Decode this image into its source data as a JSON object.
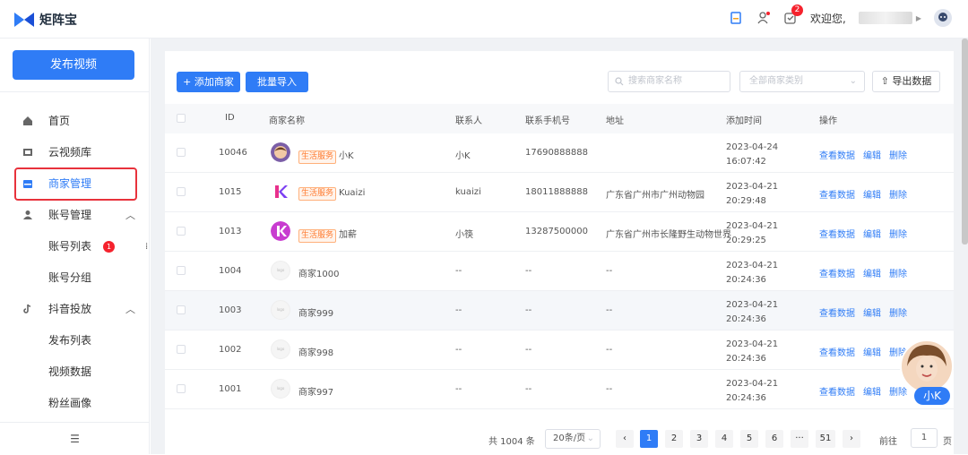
{
  "app": {
    "name": "矩阵宝"
  },
  "header": {
    "notify_count": "2",
    "welcome": "欢迎您,"
  },
  "sidebar": {
    "publish_label": "发布视频",
    "items": [
      {
        "label": "首页",
        "icon": "home-icon"
      },
      {
        "label": "云视频库",
        "icon": "video-library-icon"
      },
      {
        "label": "商家管理",
        "icon": "store-icon",
        "active": true
      },
      {
        "label": "账号管理",
        "icon": "user-icon",
        "expand": "^"
      },
      {
        "label": "账号列表",
        "badge": "1"
      },
      {
        "label": "账号分组"
      },
      {
        "label": "抖音投放",
        "icon": "tiktok-icon",
        "expand": "^"
      },
      {
        "label": "发布列表"
      },
      {
        "label": "视频数据"
      },
      {
        "label": "粉丝画像"
      }
    ]
  },
  "toolbar": {
    "add_label": "+ 添加商家",
    "import_label": "批量导入",
    "search_placeholder": "搜索商家名称",
    "category_placeholder": "全部商家类别",
    "export_label": "导出数据"
  },
  "table": {
    "headers": [
      "ID",
      "商家名称",
      "联系人",
      "联系手机号",
      "地址",
      "添加时间",
      "操作"
    ],
    "rows": [
      {
        "id": "10046",
        "tag": "生活服务",
        "name": "小K",
        "contact": "小K",
        "phone": "17690888888",
        "address": "",
        "date": "2023-04-24",
        "time": "16:07:42",
        "avatar": "photo"
      },
      {
        "id": "1015",
        "tag": "生活服务",
        "name": "Kuaizi",
        "contact": "kuaizi",
        "phone": "18011888888",
        "address": "广东省广州市广州动物园",
        "date": "2023-04-21",
        "time": "20:29:48",
        "avatar": "k-logo"
      },
      {
        "id": "1013",
        "tag": "生活服务",
        "name": "加薪",
        "contact": "小筷",
        "phone": "13287500000",
        "address": "广东省广州市长隆野生动物世界",
        "date": "2023-04-21",
        "time": "20:29:25",
        "avatar": "k-logo-round"
      },
      {
        "id": "1004",
        "tag": "",
        "name": "商家1000",
        "contact": "--",
        "phone": "--",
        "address": "--",
        "date": "2023-04-21",
        "time": "20:24:36",
        "avatar": "placeholder"
      },
      {
        "id": "1003",
        "tag": "",
        "name": "商家999",
        "contact": "--",
        "phone": "--",
        "address": "--",
        "date": "2023-04-21",
        "time": "20:24:36",
        "avatar": "placeholder"
      },
      {
        "id": "1002",
        "tag": "",
        "name": "商家998",
        "contact": "--",
        "phone": "--",
        "address": "--",
        "date": "2023-04-21",
        "time": "20:24:36",
        "avatar": "placeholder"
      },
      {
        "id": "1001",
        "tag": "",
        "name": "商家997",
        "contact": "--",
        "phone": "--",
        "address": "--",
        "date": "2023-04-21",
        "time": "20:24:36",
        "avatar": "placeholder"
      }
    ],
    "actions": [
      "查看数据",
      "编辑",
      "删除"
    ]
  },
  "pagination": {
    "total": "共 1004 条",
    "page_size": "20条/页",
    "pages": [
      "1",
      "2",
      "3",
      "4",
      "5",
      "6",
      "···",
      "51"
    ],
    "current": "1",
    "goto_label": "前往",
    "goto_value": "1",
    "goto_suffix": "页"
  },
  "assistant": {
    "label": "小K"
  },
  "colors": {
    "primary": "#2f7cf6",
    "danger": "#f5222d",
    "tag": "#ff7a2f"
  }
}
